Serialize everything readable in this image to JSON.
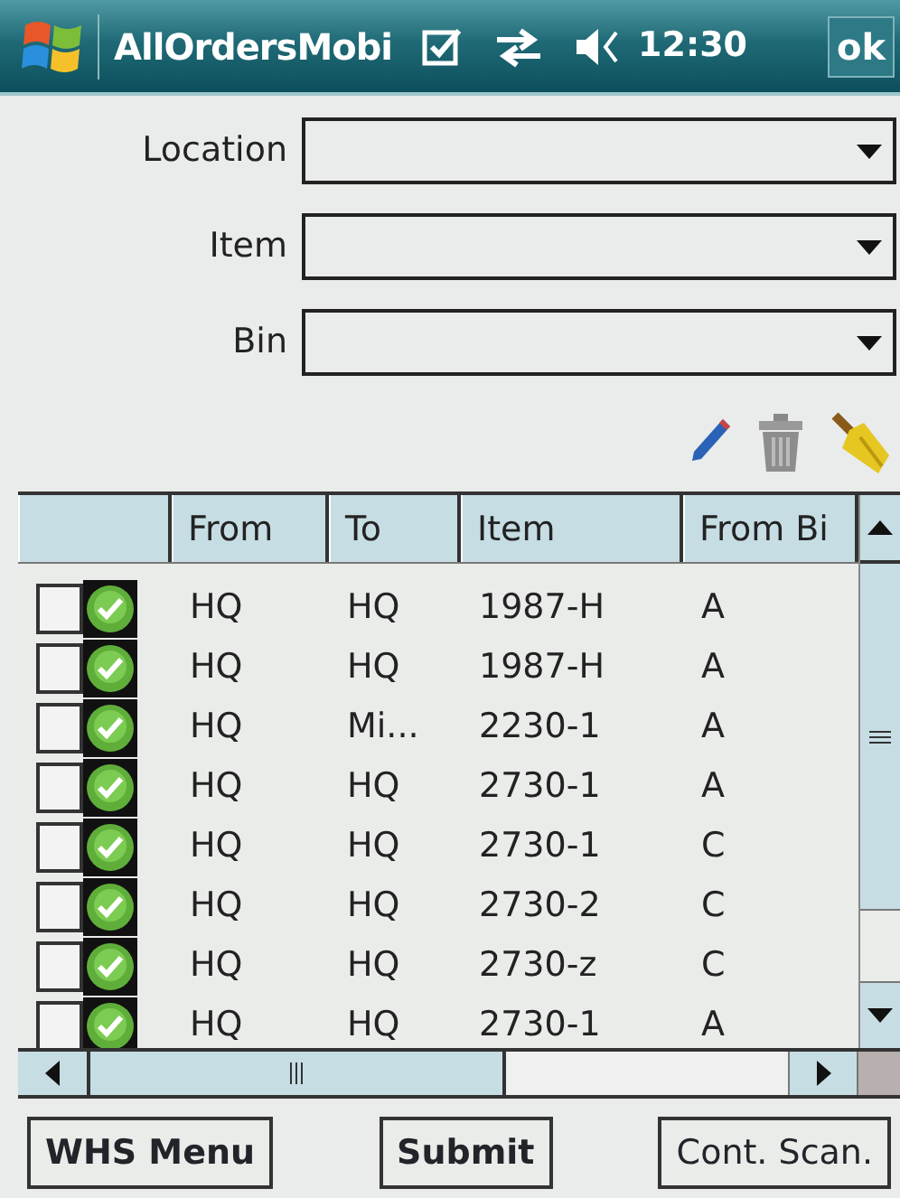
{
  "title_bar": {
    "title": "AllOrdersMobi",
    "time": "12:30",
    "ok": "ok"
  },
  "filters": [
    {
      "label": "Location"
    },
    {
      "label": "Item"
    },
    {
      "label": "Bin"
    }
  ],
  "table": {
    "columns": [
      "From",
      "To",
      "Item",
      "From Bi"
    ],
    "rows": [
      {
        "checked": false,
        "cells": [
          "HQ",
          "HQ",
          "1987-H",
          "A"
        ]
      },
      {
        "checked": false,
        "cells": [
          "HQ",
          "HQ",
          "1987-H",
          "A"
        ]
      },
      {
        "checked": false,
        "cells": [
          "HQ",
          "Mi...",
          "2230-1",
          "A"
        ]
      },
      {
        "checked": false,
        "cells": [
          "HQ",
          "HQ",
          "2730-1",
          "A"
        ]
      },
      {
        "checked": false,
        "cells": [
          "HQ",
          "HQ",
          "2730-1",
          "C"
        ]
      },
      {
        "checked": false,
        "cells": [
          "HQ",
          "HQ",
          "2730-2",
          "C"
        ]
      },
      {
        "checked": false,
        "cells": [
          "HQ",
          "HQ",
          "2730-z",
          "C"
        ]
      },
      {
        "checked": false,
        "cells": [
          "HQ",
          "HQ",
          "2730-1",
          "A"
        ]
      }
    ]
  },
  "buttons": [
    "WHS Menu",
    "Submit",
    "Cont. Scan."
  ]
}
